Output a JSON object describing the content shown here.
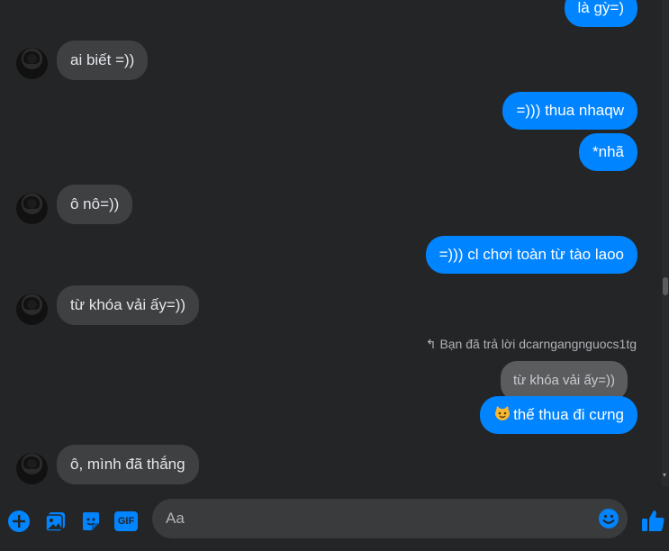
{
  "messages": [
    {
      "side": "out",
      "text": "là gỳ=)"
    },
    {
      "side": "in",
      "text": "ai biết =))"
    },
    {
      "side": "out",
      "text": "=))) thua nhaqw"
    },
    {
      "side": "out",
      "text": "*nhã"
    },
    {
      "side": "in",
      "text": "ô nô=))"
    },
    {
      "side": "out",
      "text": "=))) cl chơi toàn từ tào laoo"
    },
    {
      "side": "in",
      "text": "từ khóa vải ấy=))"
    },
    {
      "side": "reply_note",
      "text": "Bạn đã trả lời dcarngangnguocs1tg"
    },
    {
      "side": "quote",
      "text": "từ khóa vải ấy=))"
    },
    {
      "side": "out",
      "text": "thế thua đi cưng",
      "emoji": "smiling-cat-emoji"
    },
    {
      "side": "in",
      "text": "ô, mình đã thắng"
    }
  ],
  "composer": {
    "placeholder": "Aa",
    "gif_label": "GIF",
    "icons": [
      "plus-icon",
      "photo-icon",
      "sticker-icon",
      "gif-icon",
      "emoji-icon",
      "like-icon"
    ]
  },
  "colors": {
    "background": "#242526",
    "incoming_bubble": "#3e4042",
    "outgoing_bubble": "#0084ff",
    "accent": "#0084ff"
  }
}
